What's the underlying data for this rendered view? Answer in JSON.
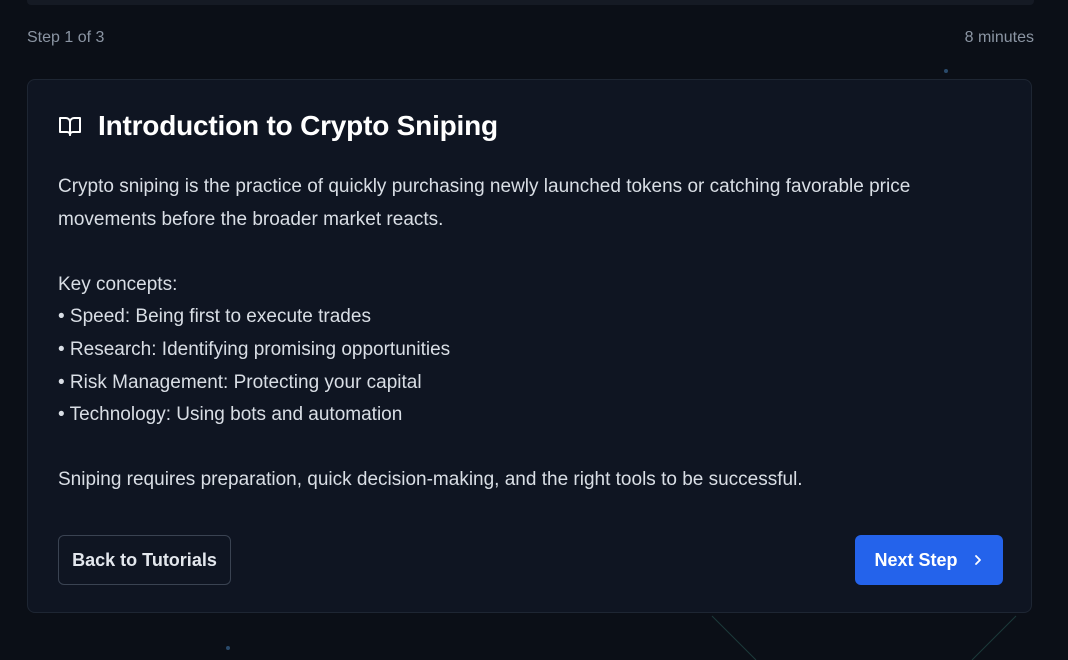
{
  "progress": {
    "step_label": "Step 1 of 3",
    "duration": "8 minutes"
  },
  "lesson": {
    "icon": "book-open-icon",
    "title": "Introduction to Crypto Sniping",
    "intro": "Crypto sniping is the practice of quickly purchasing newly launched tokens or catching favorable price movements before the broader market reacts.",
    "concepts_heading": "Key concepts:",
    "concepts": [
      "• Speed: Being first to execute trades",
      "• Research: Identifying promising opportunities",
      "• Risk Management: Protecting your capital",
      "• Technology: Using bots and automation"
    ],
    "closing": "Sniping requires preparation, quick decision-making, and the right tools to be successful."
  },
  "actions": {
    "back_label": "Back to Tutorials",
    "next_label": "Next Step",
    "next_icon": "chevron-right-icon"
  },
  "colors": {
    "background": "#0b0f17",
    "card": "#0f1522",
    "accent": "#2463eb",
    "text_muted": "#8b95a3"
  }
}
